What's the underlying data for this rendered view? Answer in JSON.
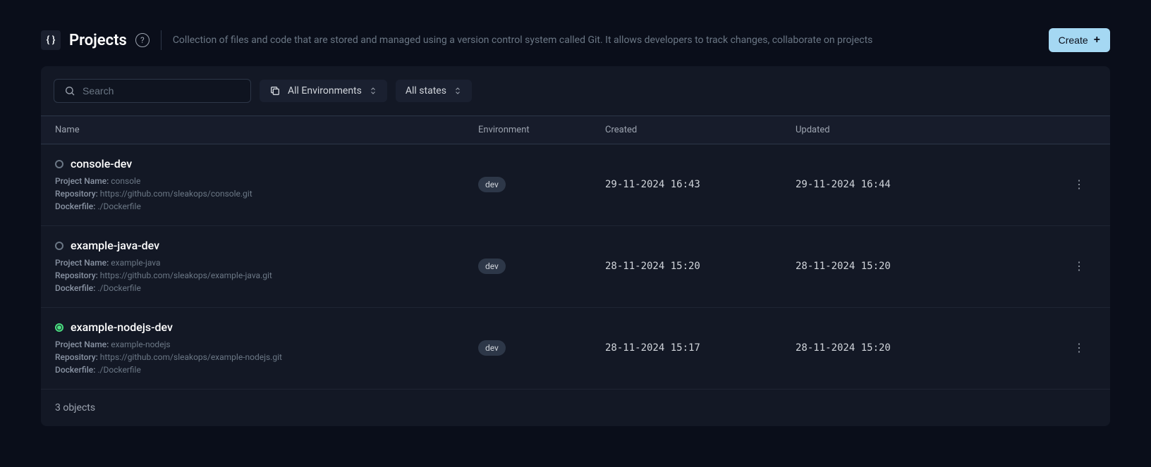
{
  "header": {
    "title": "Projects",
    "description": "Collection of files and code that are stored and managed using a version control system called Git. It allows developers to track changes, collaborate on projects",
    "create_label": "Create"
  },
  "filters": {
    "search_placeholder": "Search",
    "env_label": "All Environments",
    "state_label": "All states"
  },
  "table": {
    "columns": {
      "name": "Name",
      "environment": "Environment",
      "created": "Created",
      "updated": "Updated"
    },
    "labels": {
      "project_name": "Project Name:",
      "repository": "Repository:",
      "dockerfile": "Dockerfile:"
    },
    "rows": [
      {
        "name": "console-dev",
        "status": "grey",
        "project_name": "console",
        "repository": "https://github.com/sleakops/console.git",
        "dockerfile": "./Dockerfile",
        "environment": "dev",
        "created": "29-11-2024 16:43",
        "updated": "29-11-2024 16:44"
      },
      {
        "name": "example-java-dev",
        "status": "grey",
        "project_name": "example-java",
        "repository": "https://github.com/sleakops/example-java.git",
        "dockerfile": "./Dockerfile",
        "environment": "dev",
        "created": "28-11-2024 15:20",
        "updated": "28-11-2024 15:20"
      },
      {
        "name": "example-nodejs-dev",
        "status": "green",
        "project_name": "example-nodejs",
        "repository": "https://github.com/sleakops/example-nodejs.git",
        "dockerfile": "./Dockerfile",
        "environment": "dev",
        "created": "28-11-2024 15:17",
        "updated": "28-11-2024 15:20"
      }
    ],
    "footer": "3 objects"
  }
}
